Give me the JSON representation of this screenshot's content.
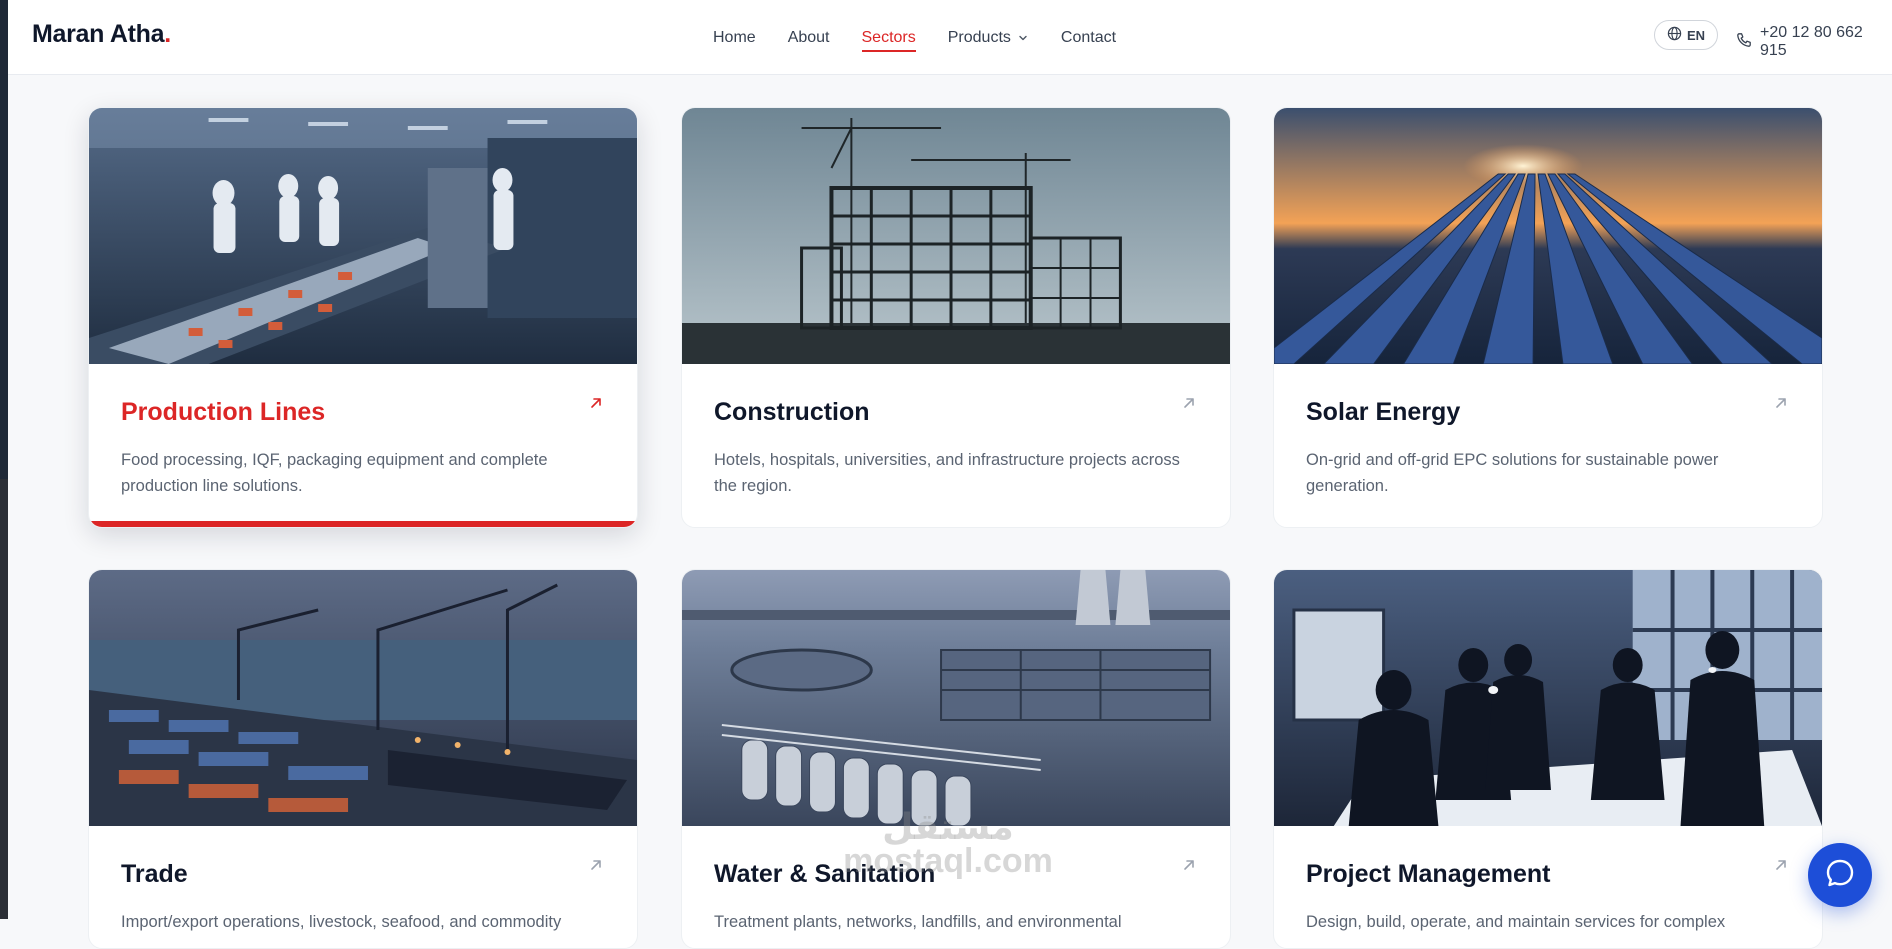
{
  "brand": {
    "name": "Maran Atha",
    "dot": ".",
    "accent": "#dc2626"
  },
  "nav": {
    "items": [
      {
        "label": "Home"
      },
      {
        "label": "About"
      },
      {
        "label": "Sectors",
        "active": true
      },
      {
        "label": "Products",
        "dropdown": true
      },
      {
        "label": "Contact"
      }
    ]
  },
  "header_right": {
    "language": "EN",
    "language_icon": "globe-icon",
    "phone": "+20 12 80 662 915",
    "phone_icon": "phone-icon"
  },
  "sectors": [
    {
      "title": "Production Lines",
      "description": "Food processing, IQF, packaging equipment and complete production line solutions.",
      "highlighted": true
    },
    {
      "title": "Construction",
      "description": "Hotels, hospitals, universities, and infrastructure projects across the region."
    },
    {
      "title": "Solar Energy",
      "description": "On-grid and off-grid EPC solutions for sustainable power generation."
    },
    {
      "title": "Trade",
      "description": "Import/export operations, livestock, seafood, and commodity"
    },
    {
      "title": "Water & Sanitation",
      "description": "Treatment plants, networks, landfills, and environmental"
    },
    {
      "title": "Project Management",
      "description": "Design, build, operate, and maintain services for complex"
    }
  ],
  "watermark": {
    "ar": "مستقل",
    "en": "mostaql.com"
  },
  "chat": {
    "icon": "chat-bubble-icon"
  }
}
